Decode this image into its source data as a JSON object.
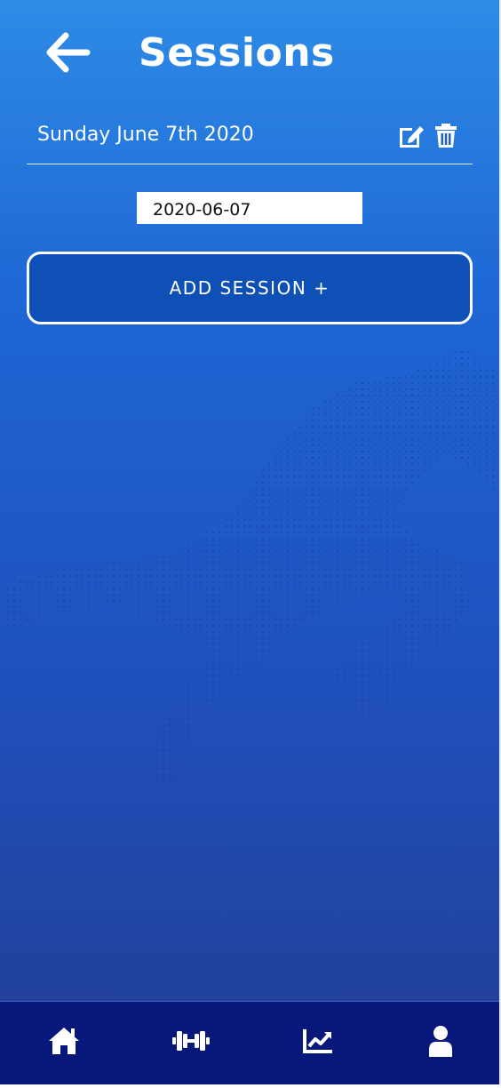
{
  "header": {
    "title": "Sessions",
    "back_icon": "arrow-left-icon"
  },
  "session": {
    "date_label": "Sunday June 7th 2020",
    "edit_icon": "edit-icon",
    "delete_icon": "trash-icon"
  },
  "date_input": {
    "value": "2020-06-07"
  },
  "add_button": {
    "label": "ADD SESSION +"
  },
  "bottom_nav": {
    "items": [
      {
        "icon": "home-icon"
      },
      {
        "icon": "dumbbell-icon"
      },
      {
        "icon": "chart-line-icon"
      },
      {
        "icon": "user-icon"
      }
    ]
  },
  "colors": {
    "gradient_top": "#2e8be6",
    "gradient_bottom": "#223d93",
    "button_fill": "#0e50b5",
    "nav_background": "#08187a",
    "text": "#ffffff"
  }
}
